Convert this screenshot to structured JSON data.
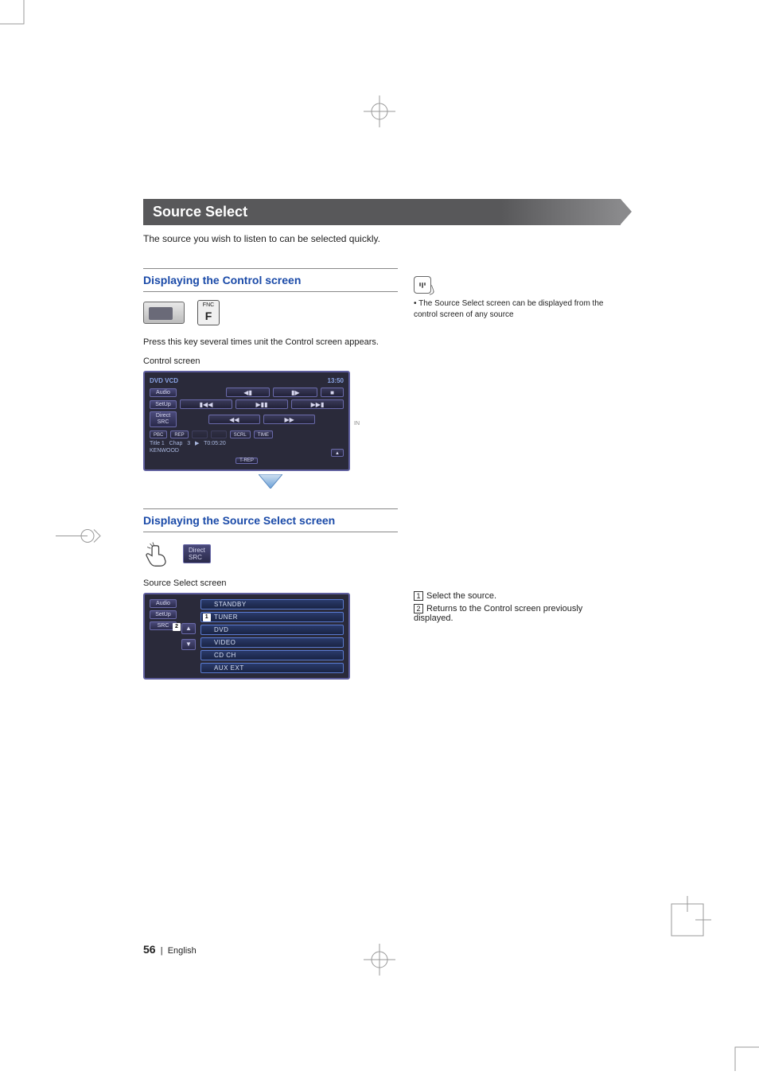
{
  "section_title": "Source Select",
  "intro": "The source you wish to listen to can be selected quickly.",
  "block1": {
    "heading": "Displaying the Control screen",
    "fnc_label_top": "FNC",
    "fnc_label_main": "F",
    "instruction": "Press this key several times unit the Control screen appears.",
    "caption": "Control screen",
    "screen": {
      "title_left": "DVD VCD",
      "title_right": "13:50",
      "side": {
        "audio": "Audio",
        "setup": "SetUp",
        "direct": "Direct\nSRC"
      },
      "transport": {
        "prev_step": "◀▮",
        "next_step": "▮▶",
        "stop": "■",
        "prev": "▮◀◀",
        "playpause": "▶▮▮",
        "next": "▶▶▮",
        "rew": "◀◀",
        "ff": "▶▶"
      },
      "status": {
        "pbc": "PBC",
        "rep": "REP",
        "scrl": "SCRL",
        "time": "TIME"
      },
      "info1_a": "Title 1",
      "info1_b": "Chap",
      "info1_c": "3",
      "info1_d": "▶",
      "info1_e": "T0:05:20",
      "info2": "KENWOOD",
      "eject": "▲",
      "trep": "T-REP",
      "in": "IN"
    }
  },
  "block2": {
    "heading": "Displaying the Source Select screen",
    "direct_btn": "Direct\nSRC",
    "caption": "Source Select screen",
    "screen": {
      "side": {
        "audio": "Audio",
        "setup": "SetUp",
        "src": "SRC"
      },
      "arrows": {
        "up": "▲",
        "down": "▼"
      },
      "items": [
        "STANDBY",
        "TUNER",
        "DVD",
        "VIDEO",
        "CD CH",
        "AUX EXT"
      ],
      "badge_item": "1",
      "badge_src": "2"
    }
  },
  "right": {
    "note": "The Source Select screen can be displayed from the control screen of any source",
    "refs": [
      {
        "n": "1",
        "text": "Select the source."
      },
      {
        "n": "2",
        "text": "Returns to the Control screen previously displayed."
      }
    ]
  },
  "footer": {
    "page": "56",
    "sep": "|",
    "lang": "English"
  }
}
